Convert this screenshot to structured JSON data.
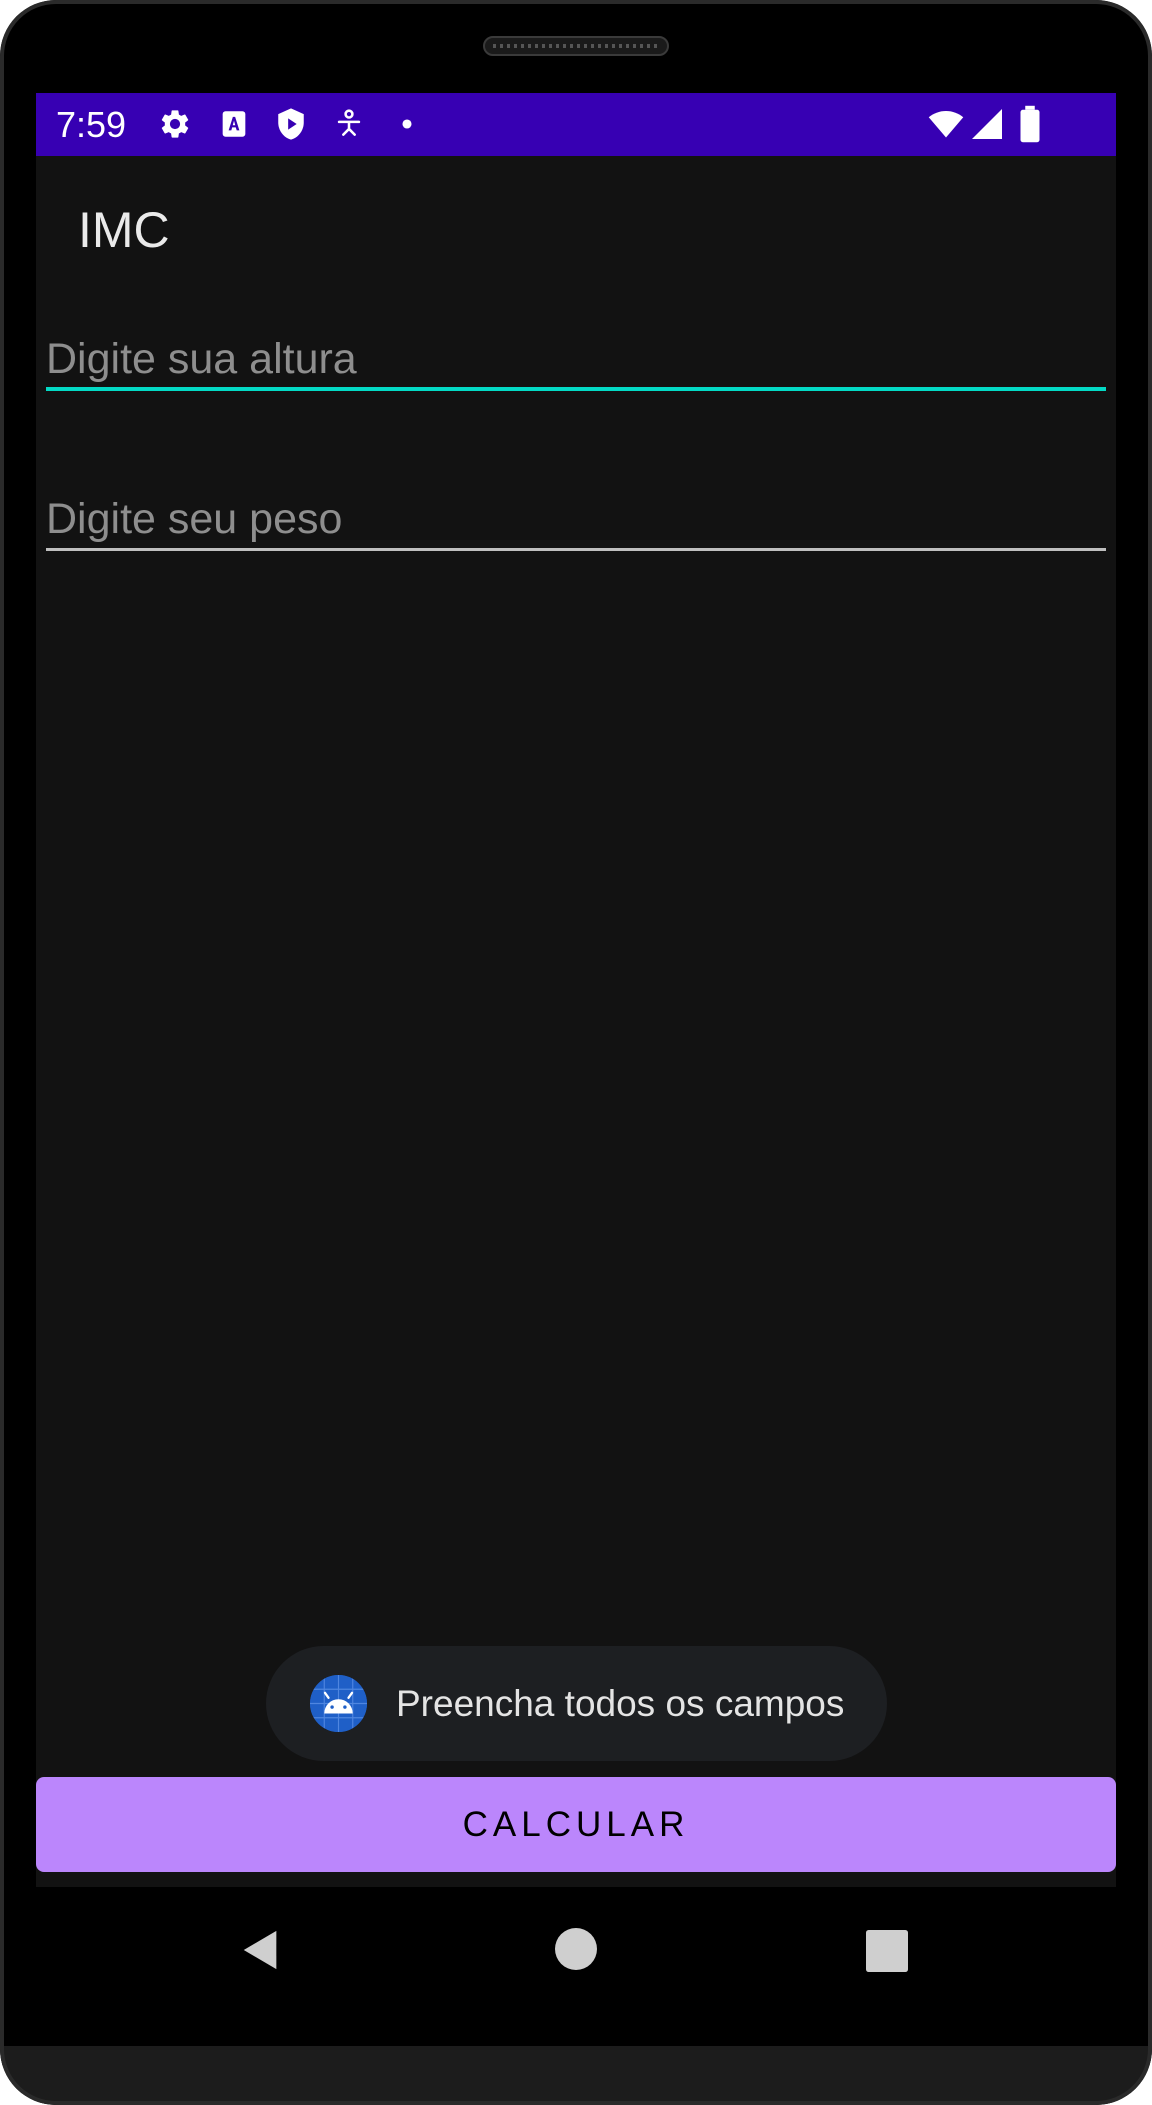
{
  "status_bar": {
    "time": "7:59",
    "left_icons": [
      "gear-icon",
      "font-a-icon",
      "shield-play-icon",
      "accessibility-icon",
      "dot-icon"
    ],
    "right_icons": [
      "wifi-icon",
      "signal-icon",
      "battery-icon"
    ],
    "color": "#3700b3"
  },
  "app_bar": {
    "title": "IMC"
  },
  "form": {
    "height_placeholder": "Digite sua altura",
    "height_value": "",
    "weight_placeholder": "Digite seu peso",
    "weight_value": ""
  },
  "toast": {
    "icon": "android-icon",
    "message": "Preencha todos os campos"
  },
  "calculate_button": {
    "label": "CALCULAR",
    "color": "#bb86fc"
  },
  "nav_bar": {
    "buttons": [
      "back-icon",
      "home-icon",
      "recents-icon"
    ]
  },
  "colors": {
    "background": "#121212",
    "accent": "#03dac5"
  }
}
